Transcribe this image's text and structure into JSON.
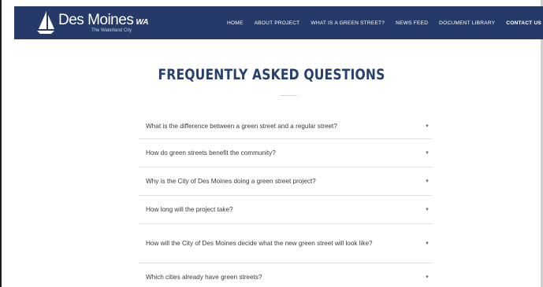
{
  "brand": {
    "name": "Des Moines",
    "state": "WA",
    "tagline": "The Waterland City"
  },
  "nav": {
    "items": [
      {
        "label": "HOME",
        "active": false
      },
      {
        "label": "ABOUT PROJECT",
        "active": false
      },
      {
        "label": "WHAT IS A GREEN STREET?",
        "active": false
      },
      {
        "label": "NEWS FEED",
        "active": false
      },
      {
        "label": "DOCUMENT LIBRARY",
        "active": false
      },
      {
        "label": "CONTACT US",
        "active": true
      }
    ]
  },
  "faq": {
    "title": "FREQUENTLY ASKED QUESTIONS",
    "items": [
      {
        "question": "What is the difference between a green street and a regular street?"
      },
      {
        "question": "How do green streets benefit the community?"
      },
      {
        "question": "Why is the City of Des Moines doing a green street project?"
      },
      {
        "question": "How long will the project take?"
      },
      {
        "question": "How will the City of Des Moines decide what the new green street will look like?"
      },
      {
        "question": "Which cities already have green streets?"
      }
    ]
  },
  "icons": {
    "logo": "sailboat-icon",
    "toggle": "caret-down-icon"
  },
  "colors": {
    "nav_background": "#253a68",
    "title": "#27406e",
    "text": "#3b3b3b",
    "divider": "#e3e3e3"
  }
}
